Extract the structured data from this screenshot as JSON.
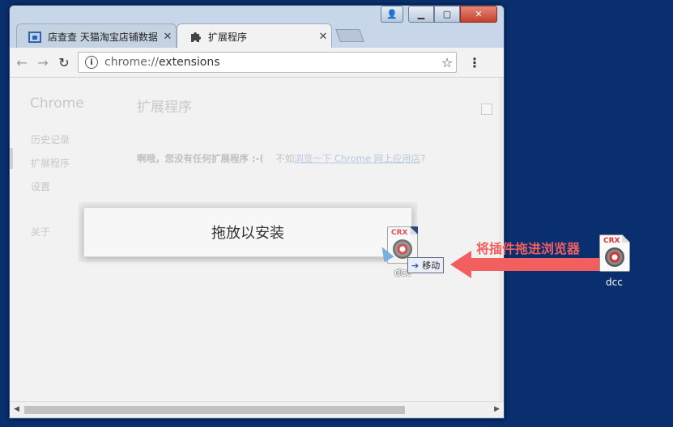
{
  "window": {
    "tabs": [
      {
        "label": "店查查 天猫淘宝店铺数据",
        "icon": "store-icon"
      },
      {
        "label": "扩展程序",
        "icon": "puzzle-icon"
      }
    ],
    "controls": [
      "user-icon",
      "minimize-icon",
      "maximize-icon",
      "close-icon"
    ]
  },
  "toolbar": {
    "url_scheme": "chrome://",
    "url_path": "extensions"
  },
  "page": {
    "brand": "Chrome",
    "title": "扩展程序",
    "sidebar": [
      "历史记录",
      "扩展程序",
      "设置",
      "关于"
    ],
    "empty_prefix": "啊哦，您没有任何扩展程序 :-(",
    "empty_mid": "不如",
    "empty_link": "浏览一下 Chrome 网上应用店",
    "empty_suffix": "?"
  },
  "drop_zone": {
    "label": "拖放以安装"
  },
  "drag": {
    "file_tag": "CRX",
    "file_name": "dcc",
    "tooltip": "移动"
  },
  "desktop": {
    "file_tag": "CRX",
    "file_name": "dcc"
  },
  "annotation": {
    "text": "将插件拖进浏览器",
    "color": "#f25f5f"
  }
}
